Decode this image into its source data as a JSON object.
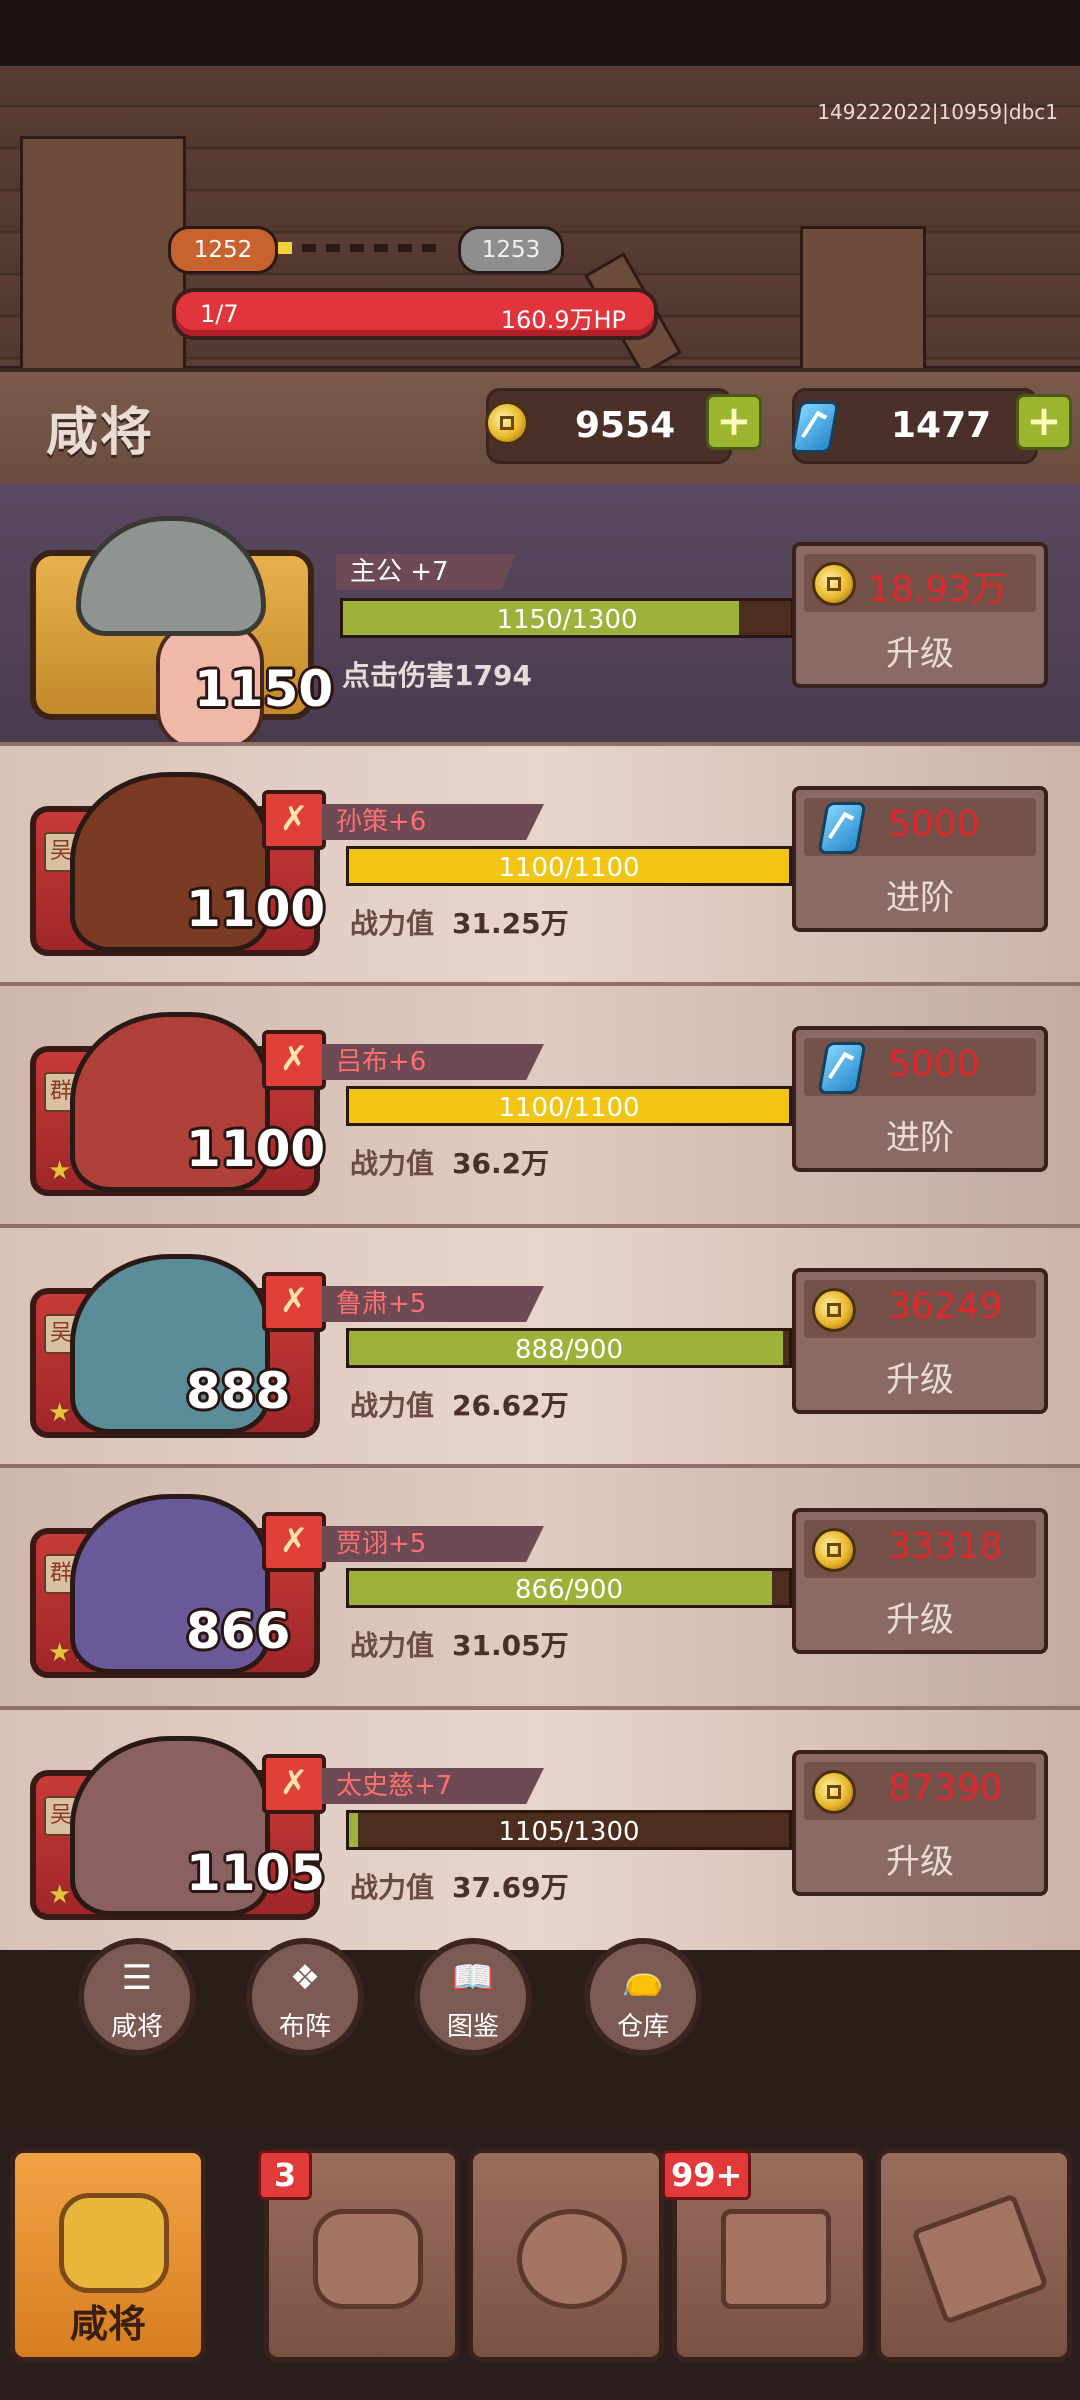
{
  "server_code": "149222022|10959|dbc1",
  "stage": {
    "current": "1252",
    "next": "1253"
  },
  "hp_bar": {
    "wave": "1/7",
    "hp": "160.9万HP"
  },
  "header": {
    "title": "咸将",
    "coins": "9554",
    "gems": "1477"
  },
  "lord": {
    "name": "主公 +7",
    "level": "1150",
    "progress_text": "1150/1300",
    "progress": 0.885,
    "tap_damage": "点击伤害1794",
    "cost": "18.93万",
    "action": "升级"
  },
  "heroes": [
    {
      "faction": "吴",
      "name": "孙策+6",
      "level": "1100",
      "progress_text": "1100/1100",
      "progress": 1.0,
      "power_label": "战力值",
      "power": "31.25万",
      "cost": "5000",
      "cost_icon": "gem-icon",
      "action": "进阶",
      "stars": ""
    },
    {
      "faction": "群",
      "name": "吕布+6",
      "level": "1100",
      "progress_text": "1100/1100",
      "progress": 1.0,
      "power_label": "战力值",
      "power": "36.2万",
      "cost": "5000",
      "cost_icon": "gem-icon",
      "action": "进阶",
      "stars": "★"
    },
    {
      "faction": "吴",
      "name": "鲁肃+5",
      "level": "888",
      "progress_text": "888/900",
      "progress": 0.987,
      "power_label": "战力值",
      "power": "26.62万",
      "cost": "36249",
      "cost_icon": "coin-icon",
      "action": "升级",
      "stars": "★"
    },
    {
      "faction": "群",
      "name": "贾诩+5",
      "level": "866",
      "progress_text": "866/900",
      "progress": 0.962,
      "power_label": "战力值",
      "power": "31.05万",
      "cost": "33318",
      "cost_icon": "coin-icon",
      "action": "升级",
      "stars": "★★"
    },
    {
      "faction": "吴",
      "name": "太史慈+7",
      "level": "1105",
      "progress_text": "1105/1300",
      "progress": 0.02,
      "power_label": "战力值",
      "power": "37.69万",
      "cost": "87390",
      "cost_icon": "coin-icon",
      "action": "升级",
      "stars": "★"
    }
  ],
  "shortcuts": [
    {
      "label": "咸将",
      "icon": "list-icon"
    },
    {
      "label": "布阵",
      "icon": "formation-icon"
    },
    {
      "label": "图鉴",
      "icon": "book-icon"
    },
    {
      "label": "仓库",
      "icon": "bag-icon"
    }
  ],
  "tabs": [
    {
      "label": "咸将",
      "icon": "helmet-icon",
      "active": true,
      "badge": ""
    },
    {
      "label": "",
      "icon": "armor-icon",
      "active": false,
      "badge": "3"
    },
    {
      "label": "",
      "icon": "turtle-icon",
      "active": false,
      "badge": ""
    },
    {
      "label": "",
      "icon": "chest-icon",
      "active": false,
      "badge": "99+"
    },
    {
      "label": "",
      "icon": "scroll-icon",
      "active": false,
      "badge": ""
    }
  ],
  "colors": {
    "cost_red": "#e1282d",
    "bar_gold": "#f2c514",
    "bar_green": "#9db13b",
    "hp_red": "#e0353d"
  }
}
